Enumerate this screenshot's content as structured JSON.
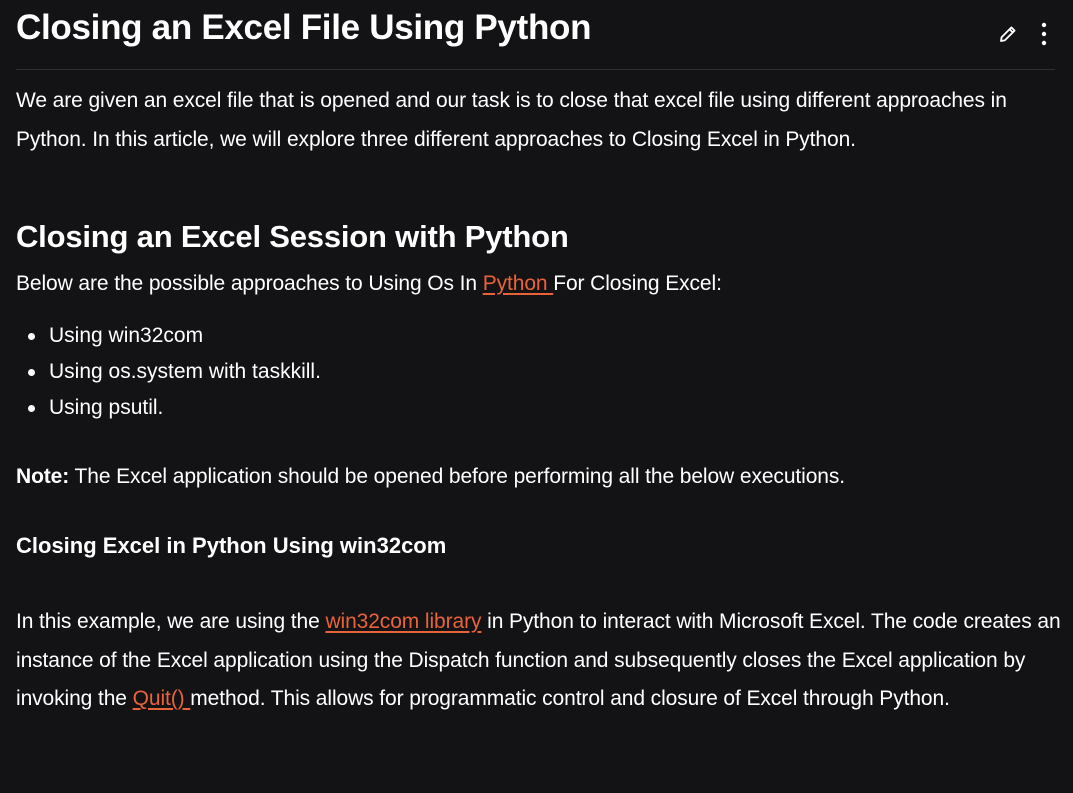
{
  "article": {
    "title": "Closing an Excel File Using Python",
    "intro": "We are given an excel file that is opened and our task is to close that excel file using different approaches in Python. In this article, we will explore three different approaches to Closing Excel in Python.",
    "section_heading": "Closing an Excel Session with Python",
    "approaches_prefix": "Below are the possible approaches to Using Os In ",
    "approaches_link": "Python ",
    "approaches_suffix": "For Closing Excel:",
    "approaches": [
      "Using win32com",
      "Using os.system with taskkill.",
      "Using psutil."
    ],
    "note_label": "Note:",
    "note_text": " The Excel application should be opened before performing all the below executions.",
    "subheading": "Closing Excel in Python Using win32com",
    "example_text_1": "In this example, we are using the ",
    "example_link_1": "win32com library",
    "example_text_2": " in Python to interact with Microsoft Excel. The code creates an instance of the Excel application using the Dispatch function and subsequently closes the Excel application by invoking the ",
    "example_link_2": "Quit() ",
    "example_text_3": "method. This allows for programmatic control and closure of Excel through Python."
  },
  "toolbar": {
    "edit_icon": "pencil-icon",
    "more_icon": "vertical-dots-icon"
  },
  "colors": {
    "background": "#131316",
    "text": "#ffffff",
    "link": "#e8633a",
    "divider": "#2e2e33"
  }
}
